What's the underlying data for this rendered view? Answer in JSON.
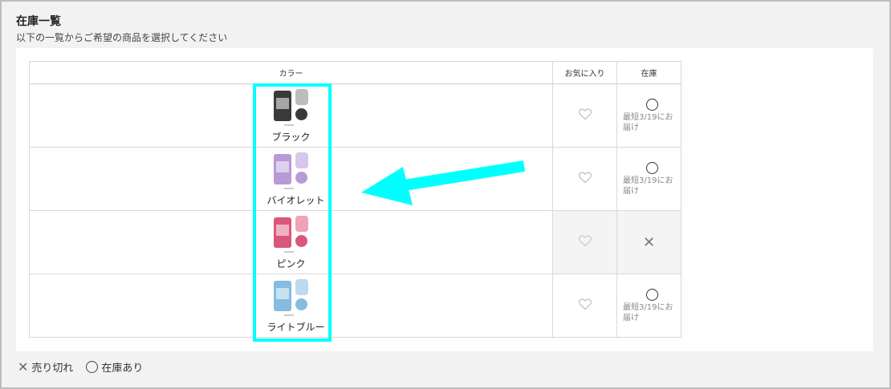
{
  "header": {
    "title": "在庫一覧",
    "subtitle": "以下の一覧からご希望の商品を選択してください"
  },
  "table": {
    "columns": [
      "カラー",
      "お気に入り",
      "在庫"
    ],
    "rows": [
      {
        "color": "ブラック",
        "stock_status": "available",
        "delivery": "最短3/19にお届け",
        "swatch": "#3a3a3a",
        "accent": "#bdbdbd"
      },
      {
        "color": "バイオレット",
        "stock_status": "available",
        "delivery": "最短3/19にお届け",
        "swatch": "#b79ad6",
        "accent": "#d9c6ee"
      },
      {
        "color": "ピンク",
        "stock_status": "sold_out",
        "delivery": "",
        "swatch": "#d9587a",
        "accent": "#eea3b7"
      },
      {
        "color": "ライトブルー",
        "stock_status": "available",
        "delivery": "最短3/19にお届け",
        "swatch": "#86bce0",
        "accent": "#bcdaf0"
      }
    ]
  },
  "icons": {
    "favorite": "heart-outline-icon",
    "available": "circle-icon",
    "sold_out": "cross-icon"
  },
  "legend": {
    "sold_out_label": "売り切れ",
    "available_label": "在庫あり"
  },
  "annotation": {
    "highlight_color": "#00ffff",
    "arrow_color": "#00ffff"
  }
}
